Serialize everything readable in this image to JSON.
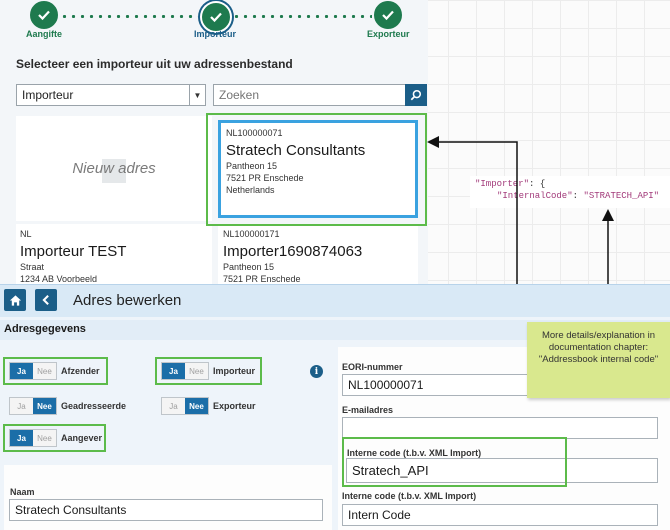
{
  "stepper": {
    "steps": [
      {
        "label": "Aangifte",
        "state": "done"
      },
      {
        "label": "Importeur",
        "state": "active"
      },
      {
        "label": "Exporteur",
        "state": "done"
      }
    ]
  },
  "select_section": {
    "title": "Selecteer een importeur uit uw adressenbestand",
    "type_select_value": "Importeur",
    "search_placeholder": "Zoeken"
  },
  "address_cards": {
    "new_label": "Nieuw adres",
    "stratech": {
      "code": "NL100000071",
      "name": "Stratech Consultants",
      "street": "Pantheon 15",
      "city": "7521 PR Enschede",
      "country": "Netherlands"
    },
    "test": {
      "code": "NL",
      "name": "Importeur TEST",
      "street": "Straat",
      "city": "1234 AB Voorbeeld"
    },
    "importer1690": {
      "code": "NL100000171",
      "name": "Importer1690874063",
      "street": "Pantheon 15",
      "city": "7521 PR Enschede"
    }
  },
  "json_snippet": {
    "line1_key": "\"Importer\"",
    "line1_rest": ": {",
    "line2_key": "\"InternalCode\"",
    "line2_sep": ": ",
    "line2_value": "\"STRATECH_API\""
  },
  "edit_panel": {
    "title": "Adres bewerken",
    "section": "Adresgegevens",
    "toggles": [
      {
        "label": "Afzender",
        "yes": "Ja",
        "no": "Nee",
        "value": "Ja"
      },
      {
        "label": "Importeur",
        "yes": "Ja",
        "no": "Nee",
        "value": "Ja"
      },
      {
        "label": "Geadresseerde",
        "yes": "Ja",
        "no": "Nee",
        "value": "Nee"
      },
      {
        "label": "Exporteur",
        "yes": "Ja",
        "no": "Nee",
        "value": "Nee"
      },
      {
        "label": "Aangever",
        "yes": "Ja",
        "no": "Nee",
        "value": "Ja"
      }
    ],
    "fields": {
      "eori_label": "EORI-nummer",
      "eori_value": "NL100000071",
      "email_label": "E-mailadres",
      "email_value": "",
      "internal_code_label_1": "Interne code (t.b.v. XML Import)",
      "internal_code_value_1": "Stratech_API",
      "internal_code_label_2": "Interne code (t.b.v. XML Import)",
      "internal_code_value_2": "Intern Code",
      "naam_label": "Naam",
      "naam_value": "Stratech Consultants"
    }
  },
  "callout": {
    "text": "More details/explanation in documentation chapter: \"Addressbook internal code\""
  },
  "colors": {
    "primary_blue": "#1b5e88",
    "step_green": "#1e7a4e",
    "highlight_green": "#5cbb4a",
    "card_blue": "#3aa2e0",
    "note_bg": "#d9e88e"
  }
}
